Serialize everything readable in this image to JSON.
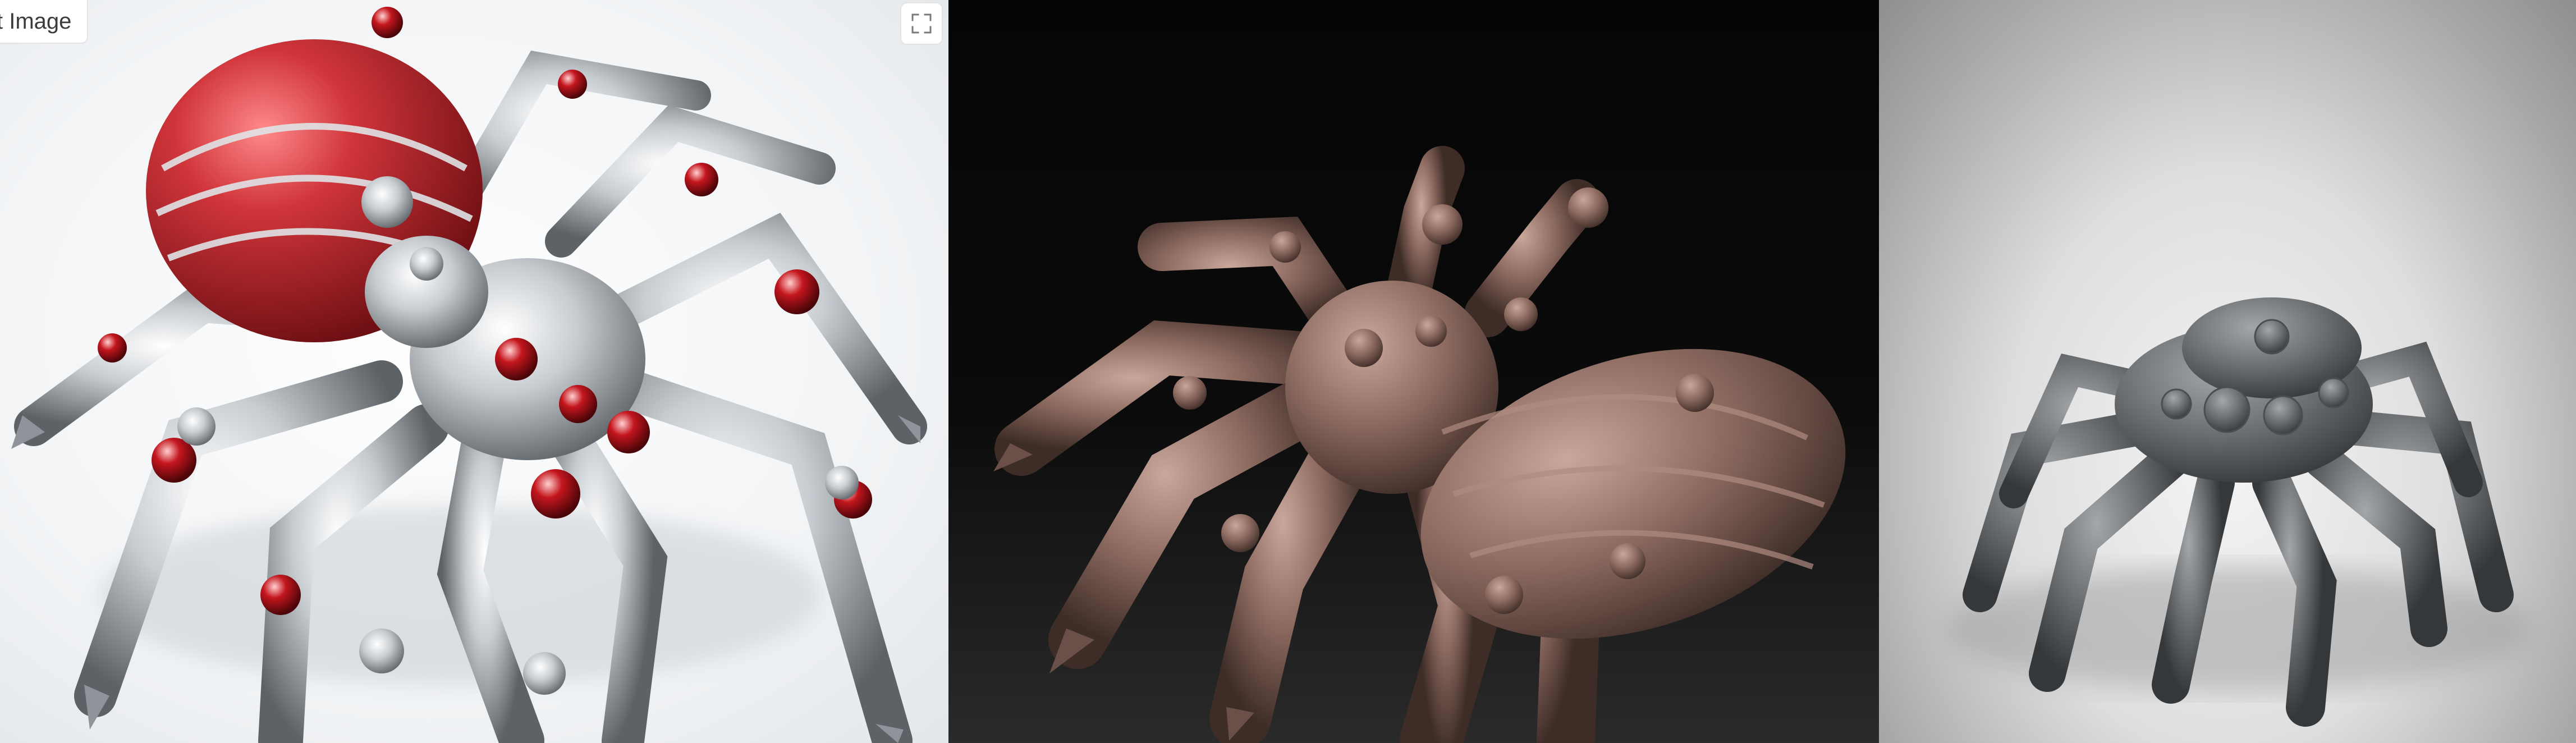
{
  "viewer": {
    "label": "t Image",
    "fullscreen_icon": "fullscreen-icon"
  },
  "images": [
    {
      "name": "chrome-red-mechanical-spider",
      "background": "#f2f4f6",
      "body_color": "#c0c4c8",
      "accent": "#b3232a"
    },
    {
      "name": "clay-sculpt-spider",
      "background": "#0b0b0b",
      "body_color": "#8c6a60",
      "accent": "#a27f74"
    },
    {
      "name": "grey-render-spider",
      "background": "#dcdcdc",
      "body_color": "#6e7174",
      "accent": "#8a8d90"
    }
  ]
}
